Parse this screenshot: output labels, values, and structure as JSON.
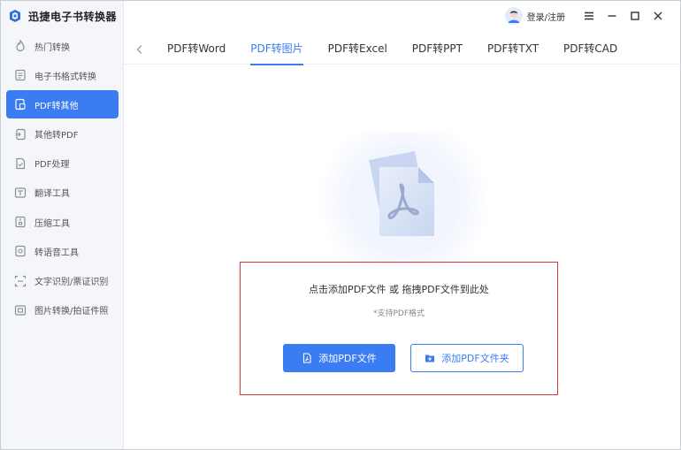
{
  "app": {
    "title": "迅捷电子书转换器",
    "accent": "#3b7cf3",
    "highlight_border": "#d9363e"
  },
  "titlebar": {
    "login_label": "登录/注册",
    "controls": [
      "menu-icon",
      "minimize-icon",
      "maximize-icon",
      "close-icon"
    ]
  },
  "sidebar": {
    "items": [
      {
        "label": "热门转换",
        "icon": "hot-icon",
        "active": false
      },
      {
        "label": "电子书格式转换",
        "icon": "ebook-icon",
        "active": false
      },
      {
        "label": "PDF转其他",
        "icon": "pdf-export-icon",
        "active": true
      },
      {
        "label": "其他转PDF",
        "icon": "pdf-import-icon",
        "active": false
      },
      {
        "label": "PDF处理",
        "icon": "pdf-process-icon",
        "active": false
      },
      {
        "label": "翻译工具",
        "icon": "translate-icon",
        "active": false
      },
      {
        "label": "压缩工具",
        "icon": "compress-icon",
        "active": false
      },
      {
        "label": "转语音工具",
        "icon": "speech-icon",
        "active": false
      },
      {
        "label": "文字识别/票证识别",
        "icon": "ocr-icon",
        "active": false
      },
      {
        "label": "图片转换/拍证件照",
        "icon": "image-icon",
        "active": false
      }
    ]
  },
  "tabs": {
    "items": [
      {
        "label": "PDF转Word",
        "active": false
      },
      {
        "label": "PDF转图片",
        "active": true
      },
      {
        "label": "PDF转Excel",
        "active": false
      },
      {
        "label": "PDF转PPT",
        "active": false
      },
      {
        "label": "PDF转TXT",
        "active": false
      },
      {
        "label": "PDF转CAD",
        "active": false
      }
    ]
  },
  "dropzone": {
    "title": "点击添加PDF文件 或 拖拽PDF文件到此处",
    "subtitle": "*支持PDF格式",
    "add_file_label": "添加PDF文件",
    "add_folder_label": "添加PDF文件夹"
  }
}
